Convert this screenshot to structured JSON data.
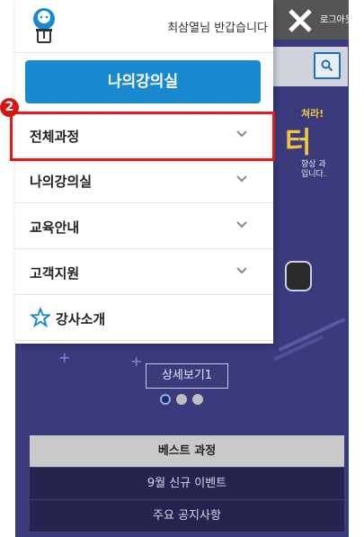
{
  "header": {
    "greeting": "최삼열님 반갑습니다",
    "logout_label": "로그아웃"
  },
  "drawer": {
    "my_classroom_button": "나의강의실",
    "menu": [
      {
        "label": "전체과정",
        "icon": "chevron-down-icon"
      },
      {
        "label": "나의강의실",
        "icon": "chevron-down-icon"
      },
      {
        "label": "교육안내",
        "icon": "chevron-down-icon"
      },
      {
        "label": "고객지원",
        "icon": "chevron-down-icon"
      },
      {
        "label": "강사소개",
        "icon": "star-icon"
      }
    ]
  },
  "annotation": {
    "badge_number": "2",
    "highlight_color": "#e41a1a"
  },
  "background_page": {
    "promo_top": "쳐라!",
    "promo_big": "터",
    "promo_side": [
      "향상 과",
      "입니다."
    ],
    "detail_button": "상세보기1",
    "slider_dots": 3,
    "slider_active_index": 0,
    "tabs": [
      "베스트 과정",
      "9월 신규 이벤트",
      "주요 공지사항"
    ],
    "active_tab_index": 0
  },
  "colors": {
    "primary_blue": "#1a8ad0",
    "page_navy": "#3a3a7c"
  }
}
